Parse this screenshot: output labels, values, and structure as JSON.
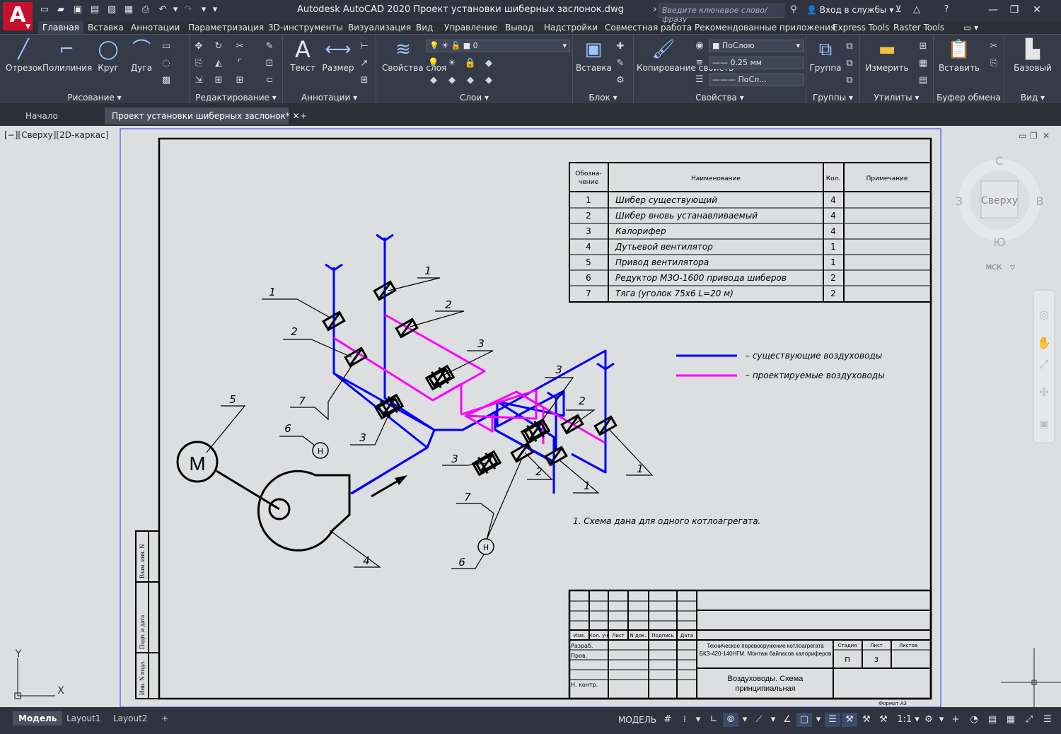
{
  "titlebar": {
    "title": "Autodesk AutoCAD 2020   Проект установки шиберных заслонок.dwg",
    "search_placeholder": "Введите ключевое слово/фразу",
    "signin": "Вход в службы"
  },
  "ribbon_tabs": [
    "Главная",
    "Вставка",
    "Аннотации",
    "Параметризация",
    "3D-инструменты",
    "Визуализация",
    "Вид",
    "Управление",
    "Вывод",
    "Надстройки",
    "Совместная работа",
    "Рекомендованные приложения",
    "Express Tools",
    "Raster Tools"
  ],
  "ribbon": {
    "draw": {
      "title": "Рисование",
      "tools": [
        "Отрезок",
        "Полилиния",
        "Круг",
        "Дуга"
      ]
    },
    "modify": {
      "title": "Редактирование"
    },
    "annotation": {
      "title": "Аннотации",
      "tools": [
        "Текст",
        "Размер"
      ]
    },
    "layers": {
      "title": "Слои",
      "tool": "Свойства слоя",
      "layer_value": "0"
    },
    "block": {
      "title": "Блок",
      "tool": "Вставка"
    },
    "properties": {
      "title": "Свойства",
      "tool": "Копирование свойств",
      "color": "ПоСлою",
      "lineweight": "0.25 мм",
      "linetype": "ПоСл..."
    },
    "groups": {
      "title": "Группы",
      "tool": "Группа"
    },
    "utilities": {
      "title": "Утилиты",
      "tool": "Измерить"
    },
    "clipboard": {
      "title": "Буфер обмена",
      "tool": "Вставить"
    },
    "view": {
      "title": "Вид",
      "tool": "Базовый"
    }
  },
  "file_tabs": {
    "start": "Начало",
    "active": "Проект установки шиберных заслонок*"
  },
  "viewport": {
    "label": "[−][Сверху][2D-каркас]",
    "viewcube": {
      "top": "Сверху",
      "n": "С",
      "s": "Ю",
      "w": "З",
      "e": "В",
      "ucs": "МСК"
    }
  },
  "spec_table": {
    "headers": [
      "Обозна-\nчение",
      "Наименование",
      "Кол.",
      "Примечание"
    ],
    "rows": [
      [
        "1",
        "Шибер существующий",
        "4",
        ""
      ],
      [
        "2",
        "Шибер вновь устанавливаемый",
        "4",
        ""
      ],
      [
        "3",
        "Калорифер",
        "4",
        ""
      ],
      [
        "4",
        "Дутьевой вентилятор",
        "1",
        ""
      ],
      [
        "5",
        "Привод вентилятора",
        "1",
        ""
      ],
      [
        "6",
        "Редуктор МЗО-1600 привода шиберов",
        "2",
        ""
      ],
      [
        "7",
        "Тяга (уголок 75х6 L=20 м)",
        "2",
        ""
      ]
    ]
  },
  "legend": {
    "existing": "– существующие воздуховоды",
    "projected": "– проектируемые воздуховоды",
    "existing_color": "#0000ff",
    "projected_color": "#ff00ff"
  },
  "note": "1. Схема дана для одного котлоагрегата.",
  "title_block": {
    "col_headers": [
      "Изм.",
      "Кол. уч",
      "Лист",
      "N док.",
      "Подпись",
      "Дата"
    ],
    "roles": [
      "Разраб.",
      "Пров.",
      "",
      "Н. контр."
    ],
    "project": "Техническое перевооружение котлоагрегата БКЗ-420-140НГМ. Монтаж байпасов калориферов",
    "stage_header": "Стадия",
    "sheet_header": "Лист",
    "sheets_header": "Листов",
    "stage": "П",
    "sheet": "3",
    "drawing_name": "Воздуховоды. Схема принципиальная",
    "format": "Формат А3",
    "side_stamps": [
      "Взам. инв. N",
      "Подп. и дата",
      "Инв. N подл."
    ]
  },
  "callouts": {
    "motor": "M",
    "gauge": "Н"
  },
  "statusbar": {
    "tabs": [
      "Модель",
      "Layout1",
      "Layout2"
    ],
    "model_label": "МОДЕЛЬ",
    "scale": "1:1"
  }
}
